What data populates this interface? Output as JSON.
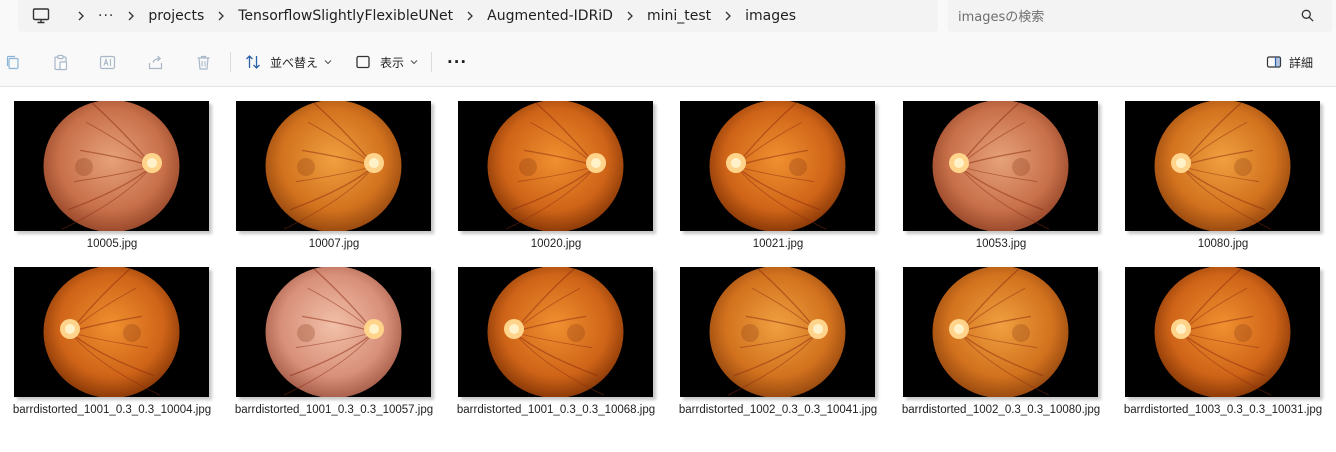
{
  "address_bar": {
    "overflow_label": "···",
    "breadcrumb": [
      "projects",
      "TensorflowSlightlyFlexibleUNet",
      "Augmented-IDRiD",
      "mini_test",
      "images"
    ]
  },
  "search": {
    "placeholder": "imagesの検索"
  },
  "toolbar": {
    "sort_label": "並べ替え",
    "view_label": "表示",
    "more_label": "···",
    "details_label": "詳細"
  },
  "files": [
    {
      "name": "10005.jpg",
      "tone": "pale",
      "disc": "right"
    },
    {
      "name": "10007.jpg",
      "tone": "amber",
      "disc": "right"
    },
    {
      "name": "10020.jpg",
      "tone": "deep",
      "disc": "right"
    },
    {
      "name": "10021.jpg",
      "tone": "deep",
      "disc": "left"
    },
    {
      "name": "10053.jpg",
      "tone": "pale",
      "disc": "left"
    },
    {
      "name": "10080.jpg",
      "tone": "amber",
      "disc": "left"
    },
    {
      "name": "barrdistorted_1001_0.3_0.3_10004.jpg",
      "tone": "deep",
      "disc": "left"
    },
    {
      "name": "barrdistorted_1001_0.3_0.3_10057.jpg",
      "tone": "pink",
      "disc": "right"
    },
    {
      "name": "barrdistorted_1001_0.3_0.3_10068.jpg",
      "tone": "deep",
      "disc": "left"
    },
    {
      "name": "barrdistorted_1002_0.3_0.3_10041.jpg",
      "tone": "amber",
      "disc": "right"
    },
    {
      "name": "barrdistorted_1002_0.3_0.3_10080.jpg",
      "tone": "amber",
      "disc": "left"
    },
    {
      "name": "barrdistorted_1003_0.3_0.3_10031.jpg",
      "tone": "deep",
      "disc": "left"
    }
  ],
  "colors": {
    "pale": [
      "#e6a27a",
      "#c8704a",
      "#9a4a2c"
    ],
    "amber": [
      "#f0a040",
      "#d2721e",
      "#9a4a10"
    ],
    "deep": [
      "#f09030",
      "#cf6418",
      "#8c3a08"
    ],
    "pink": [
      "#f2c0a8",
      "#d8907a",
      "#a8604c"
    ]
  }
}
